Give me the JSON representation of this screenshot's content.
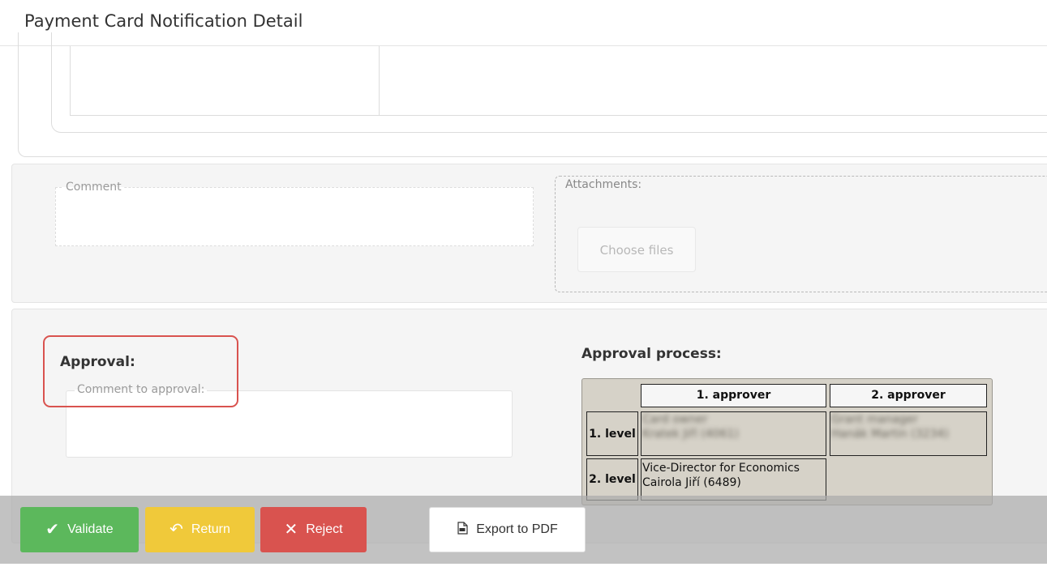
{
  "header": {
    "title": "Payment Card Notification Detail"
  },
  "comment": {
    "label": "Comment",
    "value": ""
  },
  "attachments": {
    "label": "Attachments:",
    "choose_files_label": "Choose files"
  },
  "approval": {
    "heading": "Approval:",
    "comment_label": "Comment to approval:",
    "comment_value": ""
  },
  "approval_process": {
    "heading": "Approval process:",
    "columns": [
      "1. approver",
      "2. approver"
    ],
    "levels": [
      {
        "label": "1. level",
        "approvers": [
          {
            "role": "Card owner",
            "name": "Kratek Jiří (4061)",
            "blurred": true
          },
          {
            "role": "Grant manager",
            "name": "Hanák Martin (3234)",
            "blurred": true
          }
        ]
      },
      {
        "label": "2. level",
        "approvers": [
          {
            "role": "Vice-Director for Economics",
            "name": "Cairola Jiří (6489)",
            "blurred": false
          }
        ]
      }
    ]
  },
  "actions": {
    "validate_label": "Validate",
    "return_label": "Return",
    "reject_label": "Reject",
    "export_label": "Export to PDF"
  },
  "colors": {
    "validate": "#5cb85c",
    "return": "#f0c93a",
    "reject": "#d9534f",
    "highlight": "#d9534f"
  },
  "icons": {
    "validate": "check-icon",
    "return": "undo-icon",
    "reject": "close-icon",
    "export": "pdf-icon"
  }
}
